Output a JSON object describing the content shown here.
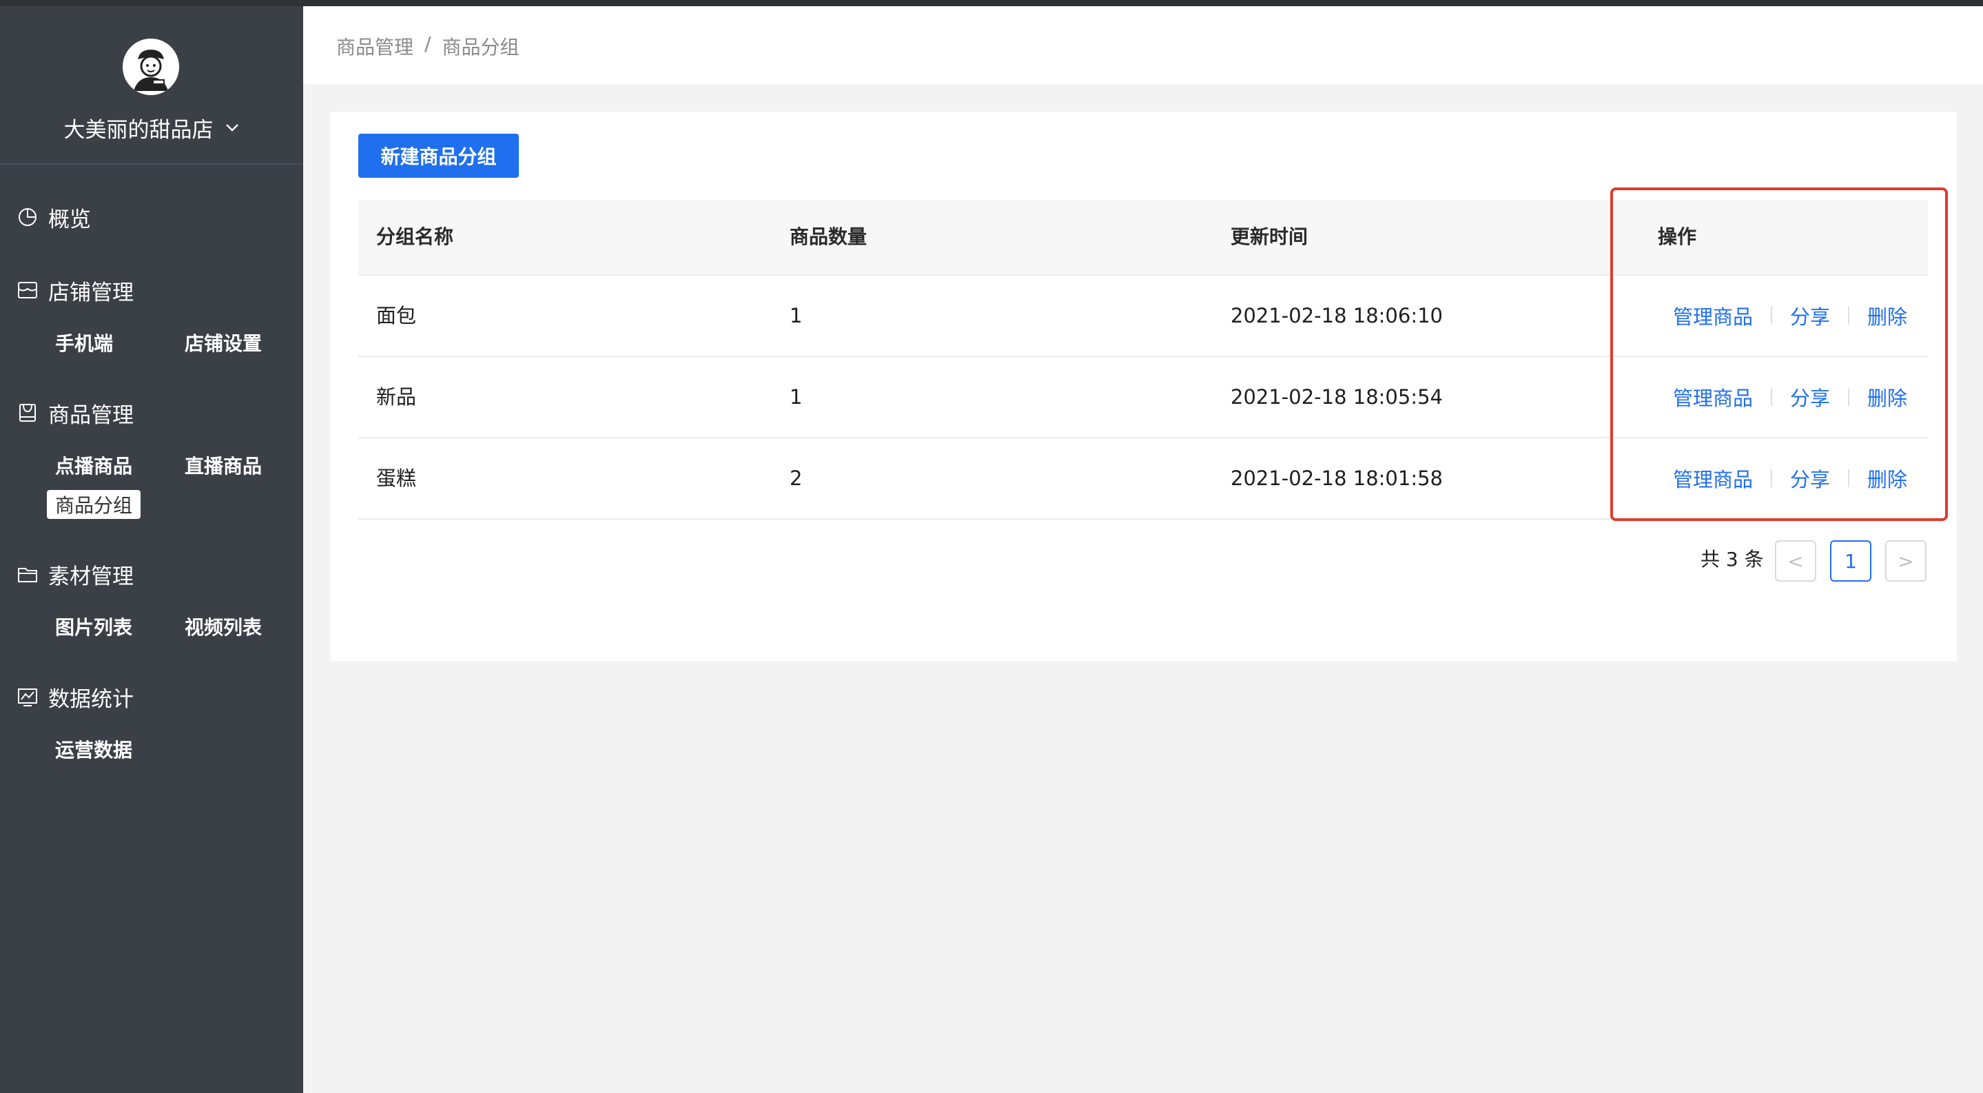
{
  "shop": {
    "name": "大美丽的甜品店"
  },
  "sidebar": {
    "overview": "概览",
    "store": {
      "label": "店铺管理",
      "items": [
        "手机端",
        "店铺设置"
      ]
    },
    "goods": {
      "label": "商品管理",
      "items": [
        "点播商品",
        "直播商品",
        "商品分组"
      ],
      "active": "商品分组"
    },
    "media": {
      "label": "素材管理",
      "items": [
        "图片列表",
        "视频列表"
      ]
    },
    "stats": {
      "label": "数据统计",
      "items": [
        "运营数据"
      ]
    }
  },
  "breadcrumb": {
    "parent": "商品管理",
    "separator": "/",
    "current": "商品分组"
  },
  "toolbar": {
    "new_group_label": "新建商品分组"
  },
  "table": {
    "columns": [
      "分组名称",
      "商品数量",
      "更新时间",
      "操作"
    ],
    "rows": [
      {
        "name": "面包",
        "count": "1",
        "updated": "2021-02-18 18:06:10"
      },
      {
        "name": "新品",
        "count": "1",
        "updated": "2021-02-18 18:05:54"
      },
      {
        "name": "蛋糕",
        "count": "2",
        "updated": "2021-02-18 18:01:58"
      }
    ],
    "actions": {
      "manage": "管理商品",
      "share": "分享",
      "delete": "删除"
    }
  },
  "pagination": {
    "total_label": "共 3 条",
    "prev": "<",
    "page": "1",
    "next": ">"
  },
  "colors": {
    "accent": "#1f6fef",
    "highlight": "#e03c2d",
    "sidebar": "#3b3f46"
  }
}
